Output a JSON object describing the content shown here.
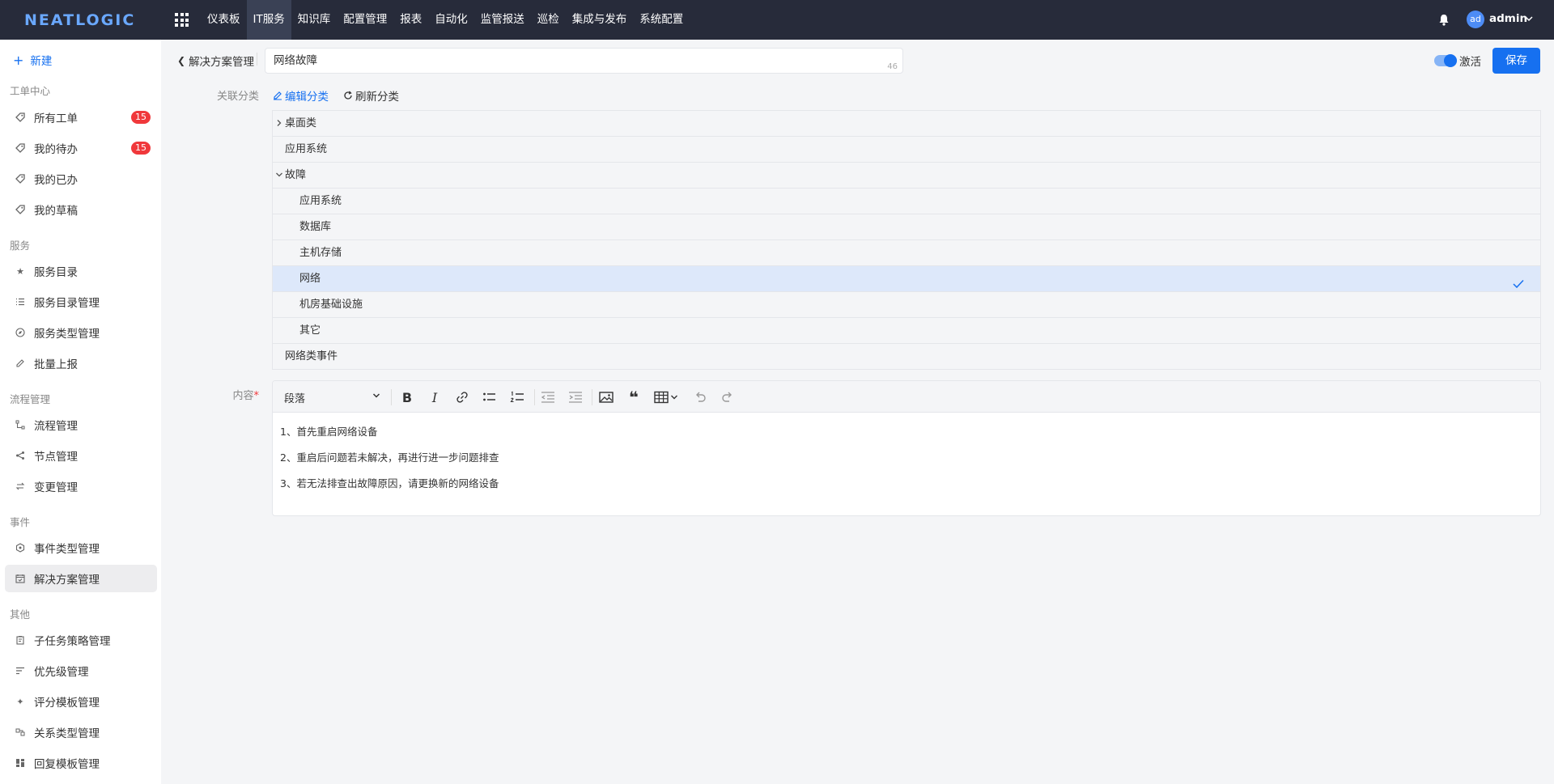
{
  "app": {
    "logo": "NEATLOGIC"
  },
  "topnav": {
    "items": [
      "仪表板",
      "IT服务",
      "知识库",
      "配置管理",
      "报表",
      "自动化",
      "监管报送",
      "巡检",
      "集成与发布",
      "系统配置"
    ],
    "active_index": 1
  },
  "user": {
    "avatar_text": "ad",
    "name": "admin"
  },
  "sidebar": {
    "new_label": "新建",
    "groups": {
      "work": "工单中心",
      "service": "服务",
      "flow": "流程管理",
      "event": "事件",
      "other": "其他"
    },
    "items": {
      "all_orders": "所有工单",
      "my_todo": "我的待办",
      "my_done": "我的已办",
      "my_drafts": "我的草稿",
      "service_catalog": "服务目录",
      "service_catalog_mgmt": "服务目录管理",
      "service_type_mgmt": "服务类型管理",
      "batch_report": "批量上报",
      "flow_mgmt": "流程管理",
      "node_mgmt": "节点管理",
      "change_mgmt": "变更管理",
      "event_type_mgmt": "事件类型管理",
      "solution_mgmt": "解决方案管理",
      "subtask_strategy_mgmt": "子任务策略管理",
      "priority_mgmt": "优先级管理",
      "rating_template_mgmt": "评分模板管理",
      "relation_type_mgmt": "关系类型管理",
      "reply_template_mgmt": "回复模板管理"
    },
    "badges": {
      "all_orders": "15",
      "my_todo": "15"
    }
  },
  "header": {
    "back_label": "解决方案管理",
    "title_value": "网络故障",
    "title_count": "46",
    "toggle_label": "激活",
    "toggle_on": true,
    "save_label": "保存"
  },
  "category": {
    "label": "关联分类",
    "edit_label": "编辑分类",
    "refresh_label": "刷新分类",
    "tree": [
      {
        "label": "桌面类",
        "level": 0,
        "caret": "collapsed"
      },
      {
        "label": "应用系统",
        "level": 0
      },
      {
        "label": "故障",
        "level": 0,
        "caret": "expanded"
      },
      {
        "label": "应用系统",
        "level": 1
      },
      {
        "label": "数据库",
        "level": 1
      },
      {
        "label": "主机存储",
        "level": 1
      },
      {
        "label": "网络",
        "level": 1,
        "selected": true
      },
      {
        "label": "机房基础设施",
        "level": 1
      },
      {
        "label": "其它",
        "level": 1
      },
      {
        "label": "网络类事件",
        "level": 0
      }
    ]
  },
  "content": {
    "label": "内容",
    "required_mark": "*",
    "paragraph_style": "段落",
    "paragraphs": [
      "1、首先重启网络设备",
      "2、重启后问题若未解决，再进行进一步问题排查",
      "3、若无法排查出故障原因，请更换新的网络设备"
    ]
  },
  "colors": {
    "accent": "#1670f0",
    "topbar": "#272b3a",
    "badge": "#f0383b",
    "selected_row": "#dde8fa"
  }
}
